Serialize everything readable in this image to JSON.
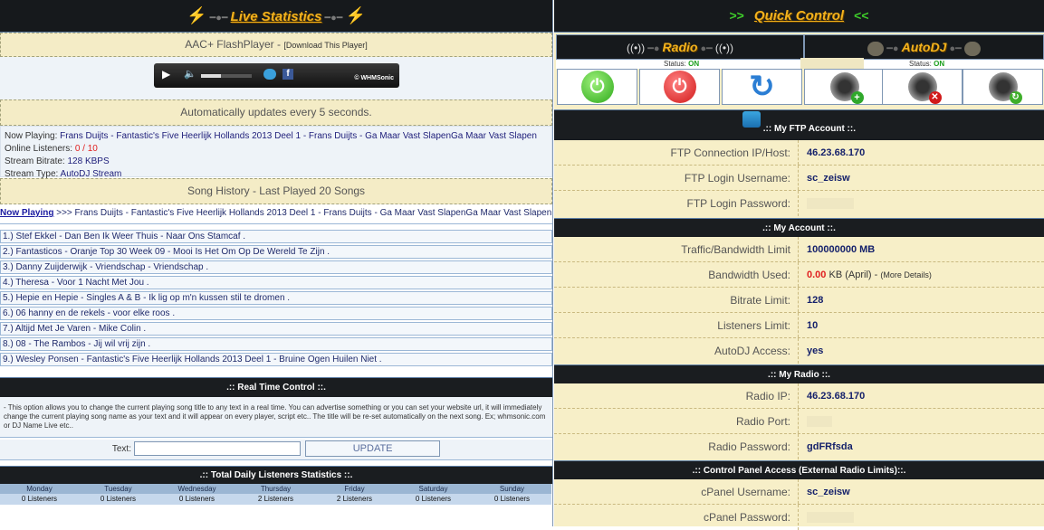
{
  "live": {
    "title": "Live Statistics",
    "player_title": "AAC+ FlashPlayer -",
    "player_link": "[Download This Player]",
    "player_brand": "© WHMSonic",
    "auto_update": "Automatically updates every 5 seconds.",
    "now_playing_label": "Now Playing:",
    "now_playing_value": "Frans Duijts - Fantastic's Five Heerlijk Hollands 2013 Deel 1 - Frans Duijts - Ga Maar Vast SlapenGa Maar Vast Slapen",
    "listeners_label": "Online Listeners:",
    "listeners_value": "0 / 10",
    "bitrate_label": "Stream Bitrate:",
    "bitrate_value": "128 KBPS",
    "type_label": "Stream Type:",
    "type_value": "AutoDJ Stream",
    "history_title": "Song History - Last Played 20 Songs",
    "np_row_label": "Now Playing",
    "np_row_arrows": ">>>",
    "np_row_value": "Frans Duijts - Fantastic's Five Heerlijk Hollands 2013 Deel 1 - Frans Duijts - Ga Maar Vast SlapenGa Maar Vast Slapen",
    "history": [
      "1.) Stef Ekkel - Dan Ben Ik Weer Thuis - Naar Ons Stamcaf .",
      "2.) Fantasticos - Oranje Top 30 Week 09 - Mooi Is Het Om Op De Wereld Te Zijn .",
      "3.) Danny Zuijderwijk - Vriendschap - Vriendschap .",
      "4.) Theresa - Voor 1 Nacht Met Jou .",
      "5.) Hepie en Hepie - Singles A & B - Ik lig op m'n kussen stil te dromen .",
      "6.) 06 hanny en de rekels - voor elke roos .",
      "7.) Altijd Met Je Varen - Mike Colin .",
      "8.) 08 - The Rambos - Jij wil vrij zijn .",
      "9.) Wesley Ponsen - Fantastic's Five Heerlijk Hollands 2013 Deel 1 - Bruine Ogen Huilen Niet ."
    ],
    "rtc_title": ".:: Real Time Control ::.",
    "rtc_desc": "- This option allows you to change the current playing song title to any text in a real time. You can advertise something or you can set your website url, it will immediately change the current playing song name as your text and it will appear on every player, script etc.. The title will be re-set automatically on the next song. Ex; whmsonic.com or DJ Name Live etc..",
    "rtc_text_label": "Text:",
    "rtc_input_value": "",
    "rtc_update": "UPDATE",
    "daily_title": ".:: Total Daily Listeners Statistics ::.",
    "days": [
      {
        "day": "Monday",
        "value": "0 Listeners"
      },
      {
        "day": "Tuesday",
        "value": "0 Listeners"
      },
      {
        "day": "Wednesday",
        "value": "0 Listeners"
      },
      {
        "day": "Thursday",
        "value": "2 Listeners"
      },
      {
        "day": "Friday",
        "value": "2 Listeners"
      },
      {
        "day": "Saturday",
        "value": "0 Listeners"
      },
      {
        "day": "Sunday",
        "value": "0 Listeners"
      }
    ]
  },
  "quick": {
    "title": "Quick Control",
    "radio_label": "Radio",
    "autodj_label": "AutoDJ",
    "status_label": "Status:",
    "radio_status": "ON",
    "autodj_status": "ON"
  },
  "ftp": {
    "title": ".:: My FTP Account ::.",
    "host_label": "FTP Connection IP/Host:",
    "host_value": "46.23.68.170",
    "user_label": "FTP Login Username:",
    "user_value": "sc_zeisw",
    "pass_label": "FTP Login Password:"
  },
  "account": {
    "title": ".:: My Account ::.",
    "traffic_label": "Traffic/Bandwidth Limit",
    "traffic_value": "100000000 MB",
    "used_label": "Bandwidth Used:",
    "used_value": "0.00",
    "used_suffix": "KB (April) -",
    "used_link": "(More Details)",
    "bitrate_label": "Bitrate Limit:",
    "bitrate_value": "128",
    "listeners_label": "Listeners Limit:",
    "listeners_value": "10",
    "autodj_label": "AutoDJ Access:",
    "autodj_value": "yes"
  },
  "radio": {
    "title": ".:: My Radio ::.",
    "ip_label": "Radio IP:",
    "ip_value": "46.23.68.170",
    "port_label": "Radio Port:",
    "pass_label": "Radio Password:",
    "pass_value": "gdFRfsda"
  },
  "cpanel": {
    "title": ".:: Control Panel Access (External Radio Limits)::.",
    "user_label": "cPanel Username:",
    "user_value": "sc_zeisw",
    "pass_label": "cPanel Password:"
  }
}
